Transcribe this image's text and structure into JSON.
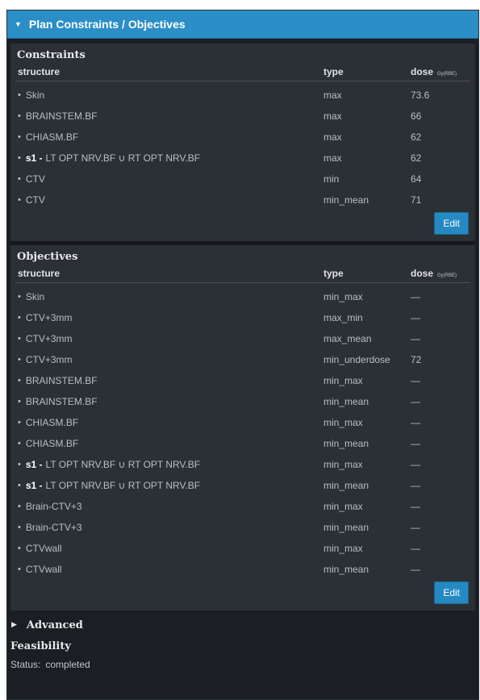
{
  "header": {
    "title": "Plan Constraints / Objectives"
  },
  "constraints": {
    "title": "Constraints",
    "columns": {
      "structure": "structure",
      "type": "type",
      "dose": "dose",
      "unit": "Gy(RBE)"
    },
    "rows": [
      {
        "prefix": "",
        "structure": "Skin",
        "type": "max",
        "dose": "73.6"
      },
      {
        "prefix": "",
        "structure": "BRAINSTEM.BF",
        "type": "max",
        "dose": "66"
      },
      {
        "prefix": "",
        "structure": "CHIASM.BF",
        "type": "max",
        "dose": "62"
      },
      {
        "prefix": "s1 -",
        "structure": "LT OPT NRV.BF ∪ RT OPT NRV.BF",
        "type": "max",
        "dose": "62"
      },
      {
        "prefix": "",
        "structure": "CTV",
        "type": "min",
        "dose": "64"
      },
      {
        "prefix": "",
        "structure": "CTV",
        "type": "min_mean",
        "dose": "71"
      }
    ],
    "edit_label": "Edit"
  },
  "objectives": {
    "title": "Objectives",
    "columns": {
      "structure": "structure",
      "type": "type",
      "dose": "dose",
      "unit": "Gy(RBE)"
    },
    "rows": [
      {
        "prefix": "",
        "structure": "Skin",
        "type": "min_max",
        "dose": "—"
      },
      {
        "prefix": "",
        "structure": "CTV+3mm",
        "type": "max_min",
        "dose": "—"
      },
      {
        "prefix": "",
        "structure": "CTV+3mm",
        "type": "max_mean",
        "dose": "—"
      },
      {
        "prefix": "",
        "structure": "CTV+3mm",
        "type": "min_underdose",
        "dose": "72"
      },
      {
        "prefix": "",
        "structure": "BRAINSTEM.BF",
        "type": "min_max",
        "dose": "—"
      },
      {
        "prefix": "",
        "structure": "BRAINSTEM.BF",
        "type": "min_mean",
        "dose": "—"
      },
      {
        "prefix": "",
        "structure": "CHIASM.BF",
        "type": "min_max",
        "dose": "—"
      },
      {
        "prefix": "",
        "structure": "CHIASM.BF",
        "type": "min_mean",
        "dose": "—"
      },
      {
        "prefix": "s1 -",
        "structure": "LT OPT NRV.BF ∪ RT OPT NRV.BF",
        "type": "min_max",
        "dose": "—"
      },
      {
        "prefix": "s1 -",
        "structure": "LT OPT NRV.BF ∪ RT OPT NRV.BF",
        "type": "min_mean",
        "dose": "—"
      },
      {
        "prefix": "",
        "structure": "Brain-CTV+3",
        "type": "min_max",
        "dose": "—"
      },
      {
        "prefix": "",
        "structure": "Brain-CTV+3",
        "type": "min_mean",
        "dose": "—"
      },
      {
        "prefix": "",
        "structure": "CTVwall",
        "type": "min_max",
        "dose": "—"
      },
      {
        "prefix": "",
        "structure": "CTVwall",
        "type": "min_mean",
        "dose": "—"
      }
    ],
    "edit_label": "Edit"
  },
  "advanced": {
    "label": "Advanced"
  },
  "feasibility": {
    "title": "Feasibility",
    "status_label": "Status:",
    "status_value": "completed"
  },
  "icons": {
    "bullet": "bullet-icon",
    "collapse": "triangle-down-icon",
    "expand": "triangle-right-icon"
  },
  "colors": {
    "header_bg": "#2b8ec7",
    "button_bg": "#2589c2",
    "panel_bg": "#1b1f23",
    "section_bg": "#2b3035"
  }
}
